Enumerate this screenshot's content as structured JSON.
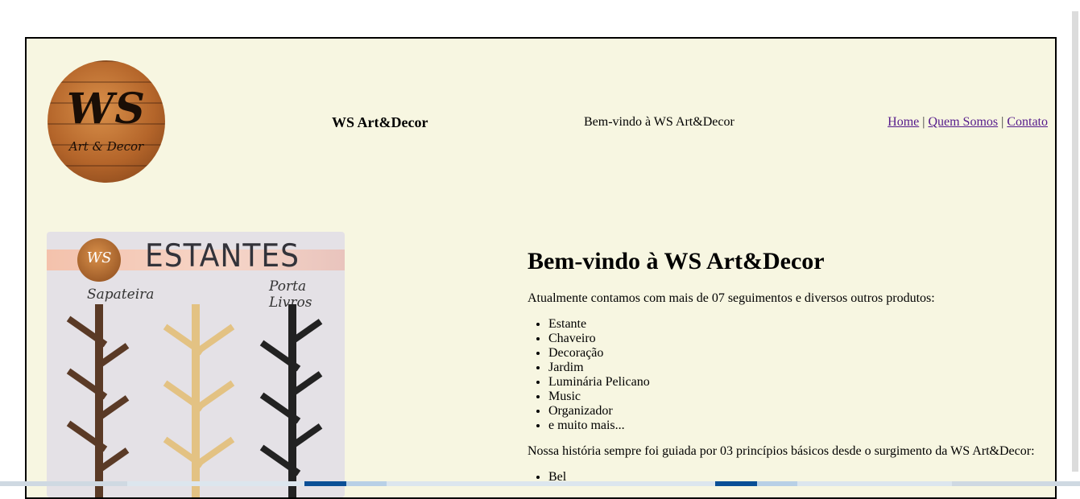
{
  "header": {
    "brand": "WS Art&Decor",
    "tagline": "Bem-vindo à WS Art&Decor",
    "logo": {
      "initials": "WS",
      "subtitle": "Art & Decor"
    },
    "nav": [
      {
        "label": "Home"
      },
      {
        "label": "Quem Somos"
      },
      {
        "label": "Contato"
      }
    ],
    "nav_separator": "|"
  },
  "hero_image": {
    "title": "ESTANTES",
    "badge": "WS",
    "left_label": "Sapateira",
    "right_label": "Porta Livros"
  },
  "main": {
    "heading": "Bem-vindo à WS Art&Decor",
    "intro": "Atualmente contamos com mais de 07 seguimentos e diversos outros produtos:",
    "products": [
      "Estante",
      "Chaveiro",
      "Decoração",
      "Jardim",
      "Luminária Pelicano",
      "Music",
      "Organizador",
      "e muito mais..."
    ],
    "history": "Nossa história sempre foi guiada por 03 princípios básicos desde o surgimento da WS Art&Decor:",
    "principles": [
      "Bel"
    ]
  },
  "colors": {
    "page_background": "#f7f6e1",
    "link": "#551a8b",
    "frame_border": "#000000"
  }
}
